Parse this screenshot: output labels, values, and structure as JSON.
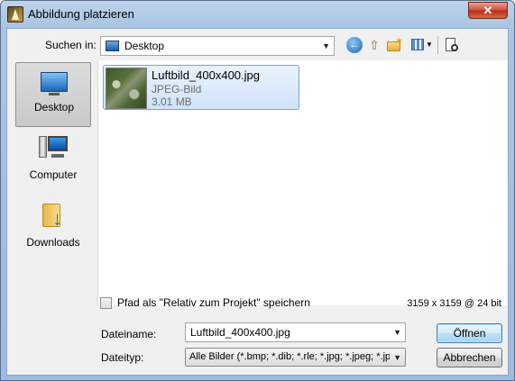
{
  "window": {
    "title": "Abbildung platzieren",
    "close_label": "✕"
  },
  "toolbar": {
    "lookin_label": "Suchen in:",
    "lookin_value": "Desktop",
    "icons": [
      "back-icon",
      "up-folder-icon",
      "new-folder-icon",
      "views-menu-icon",
      "preview-icon"
    ]
  },
  "places": [
    {
      "label": "Desktop",
      "icon": "desktop-icon",
      "selected": true
    },
    {
      "label": "Computer",
      "icon": "computer-icon",
      "selected": false
    },
    {
      "label": "Downloads",
      "icon": "downloads-folder-icon",
      "selected": false
    }
  ],
  "files": [
    {
      "name": "Luftbild_400x400.jpg",
      "type": "JPEG-Bild",
      "size": "3.01 MB",
      "selected": true
    }
  ],
  "options": {
    "relative_path_label": "Pfad als \"Relativ zum Projekt\" speichern",
    "relative_path_checked": false,
    "resolution": "3159 x 3159 @ 24 bit"
  },
  "footer": {
    "filename_label": "Dateiname:",
    "filename_value": "Luftbild_400x400.jpg",
    "filetype_label": "Dateityp:",
    "filetype_value": "Alle Bilder (*.bmp; *.dib; *.rle; *.jpg; *.jpeg; *.jpe;",
    "open_label": "Öffnen",
    "cancel_label": "Abbrechen"
  },
  "colors": {
    "accent": "#1d66b5",
    "selection": "#cfe3f8"
  }
}
